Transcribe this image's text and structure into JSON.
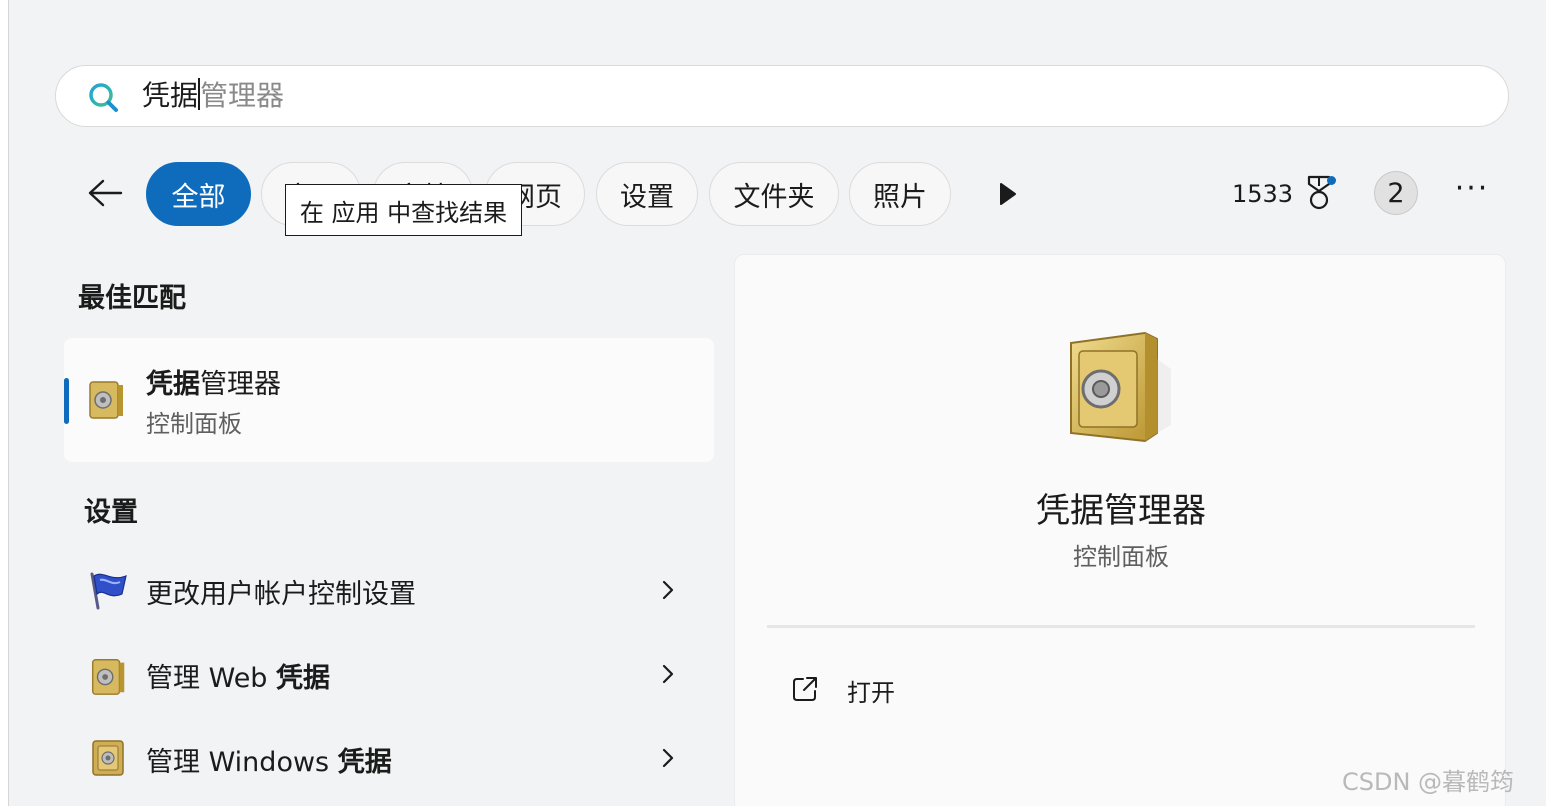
{
  "search": {
    "typed": "凭据",
    "suggestion": "管理器"
  },
  "filters": {
    "chips": [
      {
        "label": "全部",
        "active": true
      },
      {
        "label": "应用"
      },
      {
        "label": "文档"
      },
      {
        "label": "网页"
      },
      {
        "label": "设置"
      },
      {
        "label": "文件夹"
      },
      {
        "label": "照片"
      }
    ],
    "tooltip": "在 应用 中查找结果",
    "points": "1533",
    "avatar_label": "2",
    "more_label": "···"
  },
  "best_match": {
    "heading": "最佳匹配",
    "title_bold": "凭据",
    "title_rest": "管理器",
    "subtitle": "控制面板"
  },
  "settings": {
    "heading": "设置",
    "items": [
      {
        "label": "更改用户帐户控制设置",
        "icon": "uac-flag-icon"
      },
      {
        "label_pre": "管理 Web ",
        "label_bold": "凭据",
        "icon": "vault-icon"
      },
      {
        "label_pre": "管理 Windows ",
        "label_bold": "凭据",
        "icon": "vault-icon"
      }
    ]
  },
  "preview": {
    "title": "凭据管理器",
    "subtitle": "控制面板",
    "actions": [
      {
        "label": "打开",
        "icon": "open-external-icon"
      }
    ]
  },
  "watermark": "CSDN @暮鹤筠",
  "colors": {
    "accent": "#0f6cbd",
    "vault_gold": "#d8b85a"
  }
}
